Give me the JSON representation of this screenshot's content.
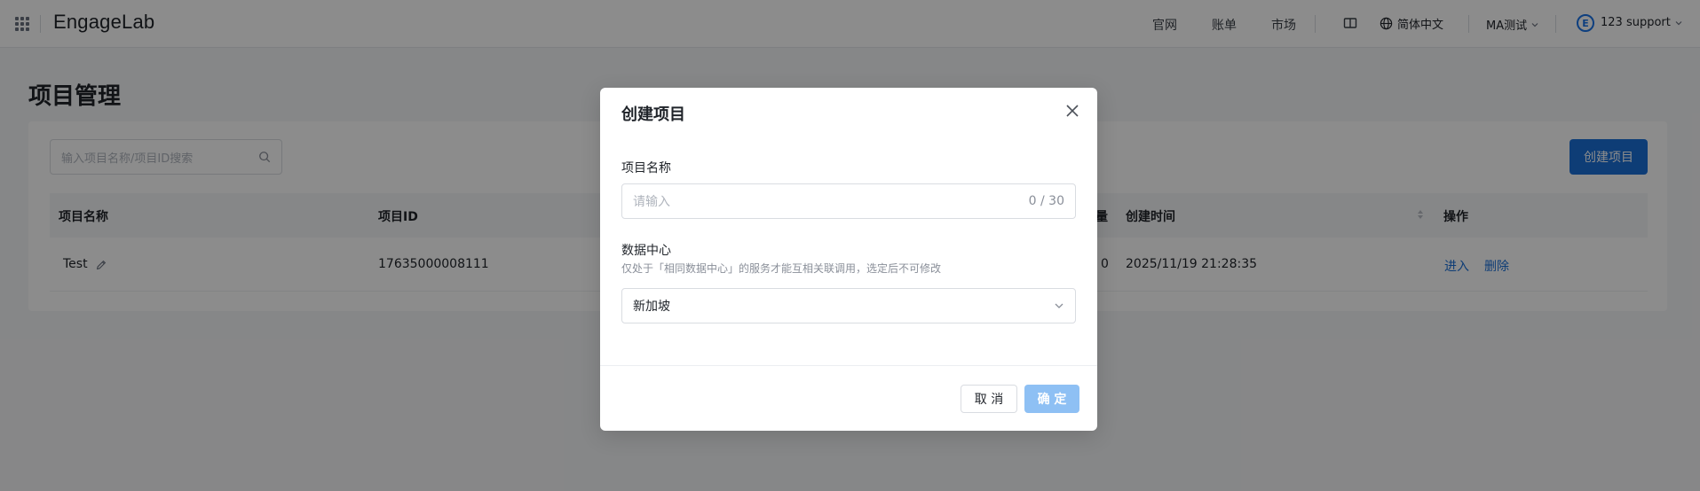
{
  "header": {
    "logo": "EngageLab",
    "nav": [
      "官网",
      "账单",
      "市场"
    ],
    "language": "简体中文",
    "workspace": "MA测试",
    "account_initial": "E",
    "account_name": "123 support"
  },
  "page": {
    "title": "项目管理",
    "search_placeholder": "输入项目名称/项目ID搜索",
    "create_button": "创建项目",
    "columns": {
      "name": "项目名称",
      "id": "项目ID",
      "count_partial": "量",
      "created": "创建时间",
      "actions": "操作"
    },
    "rows": [
      {
        "name": "Test",
        "id": "17635000008111",
        "count": "0",
        "created": "2025/11/19 21:28:35",
        "action_enter": "进入",
        "action_delete": "删除"
      }
    ]
  },
  "modal": {
    "title": "创建项目",
    "name_label": "项目名称",
    "name_placeholder": "请输入",
    "name_counter": "0 / 30",
    "dc_label": "数据中心",
    "dc_hint": "仅处于「相同数据中心」的服务才能互相关联调用，选定后不可修改",
    "dc_value": "新加坡",
    "cancel": "取 消",
    "ok": "确 定"
  },
  "colors": {
    "primary": "#1a6fd8",
    "primary_disabled": "#8ec0f4",
    "overlay": "rgba(0,0,0,0.45)"
  }
}
